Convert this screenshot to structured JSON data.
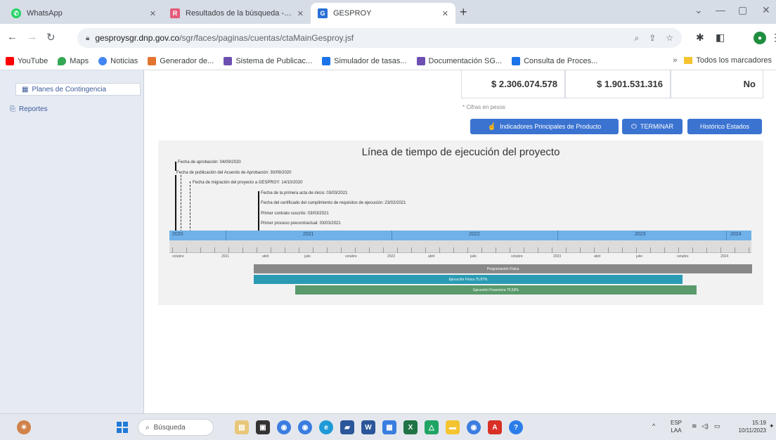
{
  "browser": {
    "tabs": [
      {
        "title": "WhatsApp",
        "icon": "whatsapp-icon",
        "color": "#25d366"
      },
      {
        "title": "Resultados de la búsqueda - Ju",
        "icon": "search-results-icon",
        "color": "#e45a7a"
      },
      {
        "title": "GESPROY",
        "icon": "gesproy-icon",
        "color": "#2a6fd6"
      }
    ],
    "address": {
      "domain": "gesproysgr.dnp.gov.co",
      "path": "/sgr/faces/paginas/cuentas/ctaMainGesproy.jsf"
    },
    "bookmarks": [
      {
        "label": "YouTube",
        "icon": "youtube-icon",
        "color": "#ff0000"
      },
      {
        "label": "Maps",
        "icon": "maps-pin-icon",
        "color": "#34a853"
      },
      {
        "label": "Noticias",
        "icon": "news-icon",
        "color": "#4285f4"
      },
      {
        "label": "Generador de...",
        "icon": "generator-icon",
        "color": "#e3742f"
      },
      {
        "label": "Sistema de Publicac...",
        "icon": "publication-system-icon",
        "color": "#6d4fb1"
      },
      {
        "label": "Simulador de tasas...",
        "icon": "rate-simulator-icon",
        "color": "#1a73e8"
      },
      {
        "label": "Documentación SG...",
        "icon": "documentation-icon",
        "color": "#6d4fb1"
      },
      {
        "label": "Consulta de Proces...",
        "icon": "process-query-icon",
        "color": "#1a73e8"
      }
    ],
    "all_bookmarks_label": "Todos los marcadores"
  },
  "sidebar": {
    "items": [
      {
        "label": "Planes de Contingencia",
        "icon": "contingency-plan-icon"
      },
      {
        "label": "Reportes",
        "icon": "reports-icon"
      }
    ]
  },
  "summary": {
    "values": [
      "$ 2.306.074.578",
      "$ 1.901.531.316",
      "No"
    ],
    "note": "* Cifras en pesos"
  },
  "actions": {
    "indicators": "Indicadores Principales de Producto",
    "finish": "TERMINAR",
    "history": "Histórico Estados"
  },
  "timeline": {
    "title": "Línea de tiempo de ejecución del proyecto",
    "events": [
      "Fecha de aprobación: 04/09/2020",
      "Fecha de publicación del Acuerdo de Aprobación: 30/09/2020",
      "Fecha de migración del proyecto a GESPROY: 14/10/2020",
      "Fecha de la primera acta de inicio: 03/03/2021",
      "Fecha del certificado del cumplimiento de requisitos de ejecución: 23/02/2021",
      "Primer contrato suscrito: 03/03/2021",
      "Primer proceso precontractual: 03/03/2021"
    ],
    "years": [
      "2020",
      "2021",
      "2022",
      "2023",
      "2024"
    ],
    "months": [
      "octubre",
      "2021",
      "abril",
      "julio",
      "octubre",
      "2022",
      "abril",
      "julio",
      "octubre",
      "2023",
      "abril",
      "julio",
      "octubre",
      "2024"
    ],
    "bars": [
      {
        "label": "Programación Física",
        "color": "#888888"
      },
      {
        "label": "Ejecución Física 75.87%",
        "color": "#2a9bb3"
      },
      {
        "label": "Ejecución Financiera 75.53%",
        "color": "#5a9a6c"
      }
    ]
  },
  "taskbar": {
    "search": "Búsqueda",
    "lang_top": "ESP",
    "lang_bottom": "LAA",
    "time": "15:19",
    "date": "10/11/2023"
  }
}
